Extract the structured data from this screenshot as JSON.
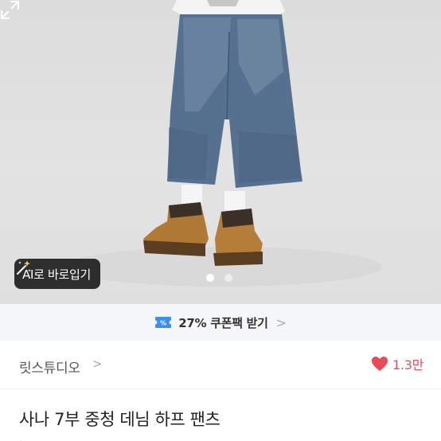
{
  "photo": {
    "ai_button_label": "AI로 바로입기",
    "ai_icon": "magic-wand-icon",
    "expand_icon": "expand-icon",
    "slides_total": 2,
    "slide_active": 1
  },
  "coupon": {
    "icon": "coupon-ticket-icon",
    "label": "27% 쿠폰팩 받기",
    "chevron": ">"
  },
  "seller": {
    "name": "릿스튜디오",
    "chevron": ">",
    "like_icon": "heart-icon",
    "like_count": "1.3만",
    "like_color": "#e94a5a"
  },
  "product": {
    "title": "사나 7부 중청 데님 하프 팬츠"
  }
}
